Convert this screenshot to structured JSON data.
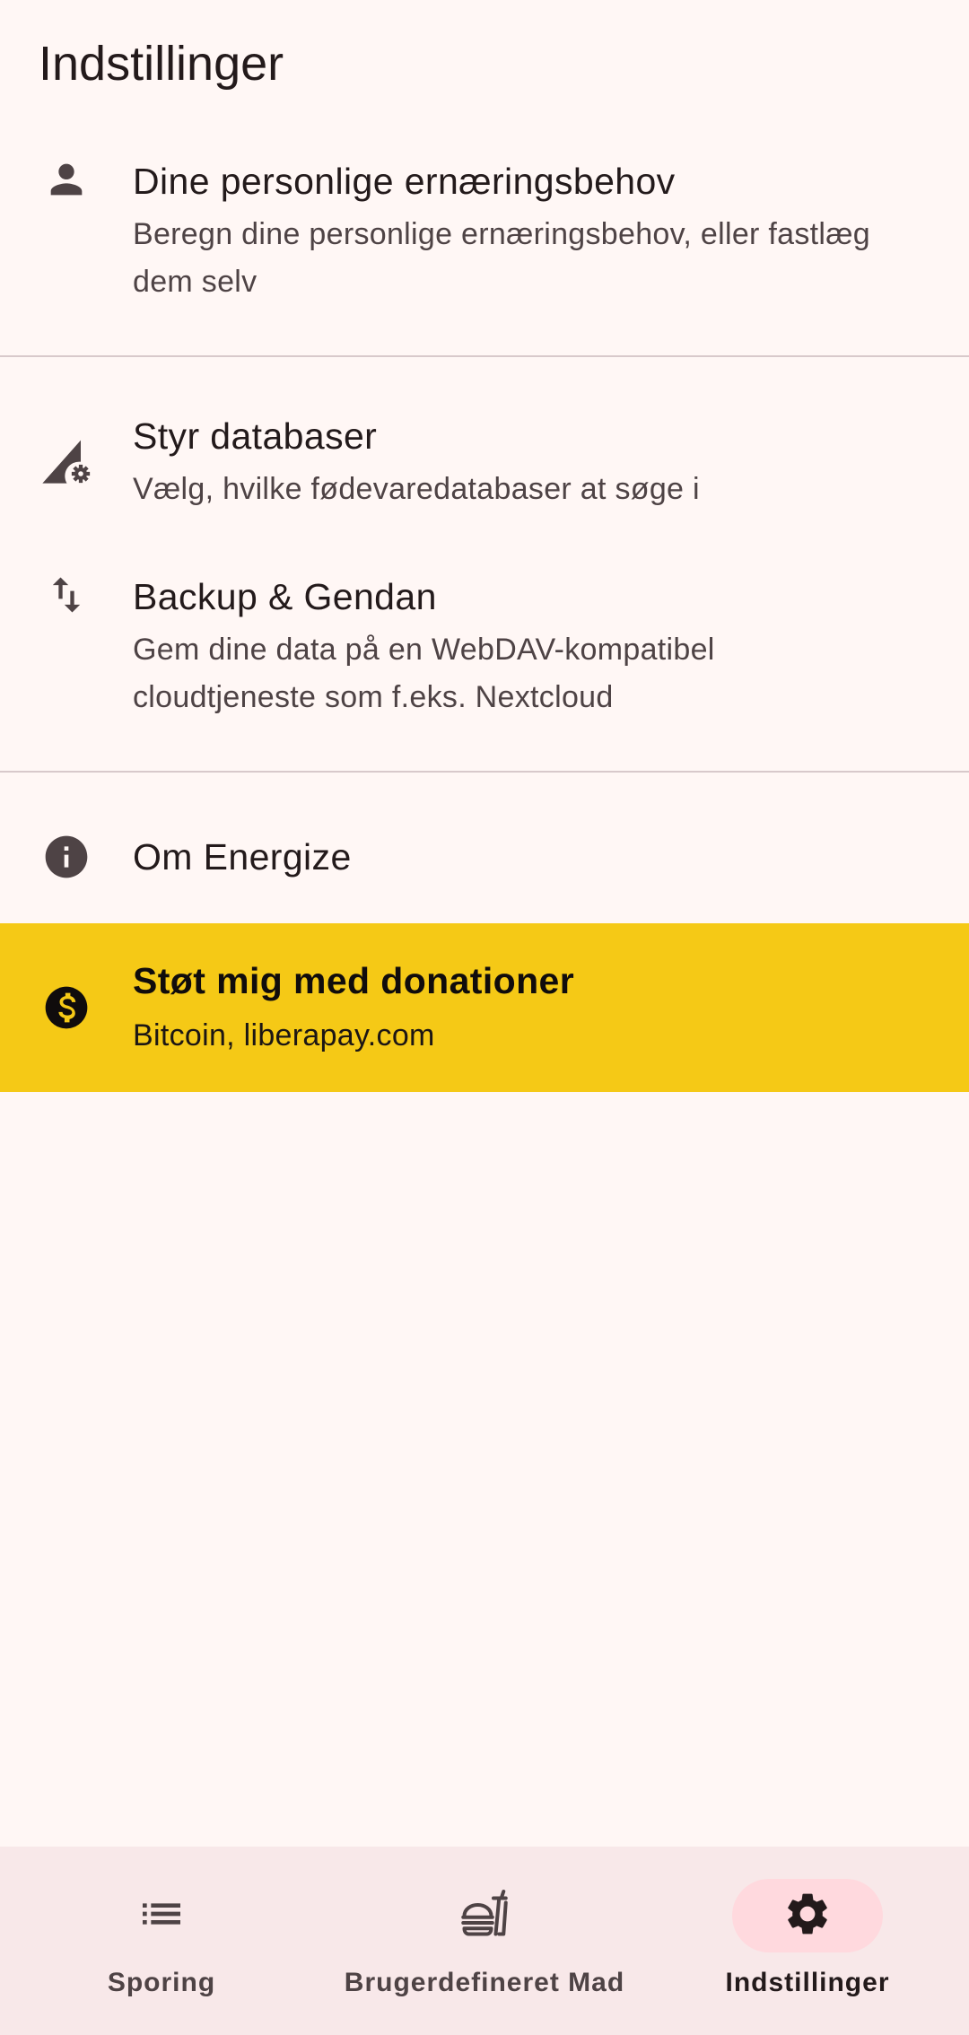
{
  "header": {
    "title": "Indstillinger"
  },
  "settings": {
    "items": [
      {
        "icon": "person-icon",
        "title": "Dine personlige ernæringsbehov",
        "subtitle": "Beregn dine personlige ernæringsbehov, eller fastlæg dem selv"
      },
      {
        "icon": "network-settings-icon",
        "title": "Styr databaser",
        "subtitle": "Vælg, hvilke fødevaredatabaser at søge i"
      },
      {
        "icon": "import-export-icon",
        "title": "Backup & Gendan",
        "subtitle": "Gem dine data på en WebDAV-kompatibel cloudtjeneste som f.eks. Nextcloud"
      },
      {
        "icon": "info-icon",
        "title": "Om Energize",
        "subtitle": ""
      }
    ],
    "donate": {
      "icon": "dollar-icon",
      "title": "Støt mig med donationer",
      "subtitle": "Bitcoin, liberapay.com",
      "background_color": "#F5C916"
    }
  },
  "bottom_nav": {
    "items": [
      {
        "icon": "list-icon",
        "label": "Sporing",
        "active": false
      },
      {
        "icon": "fastfood-icon",
        "label": "Brugerdefineret Mad",
        "active": false
      },
      {
        "icon": "gear-icon",
        "label": "Indstillinger",
        "active": true
      }
    ],
    "active_indicator_color": "#FFD9DE"
  },
  "colors": {
    "background": "#FFF7F5",
    "text_primary": "#231A1B",
    "text_secondary": "#4E4345",
    "divider": "#D8C9CB",
    "nav_background": "#F8E8E9"
  }
}
